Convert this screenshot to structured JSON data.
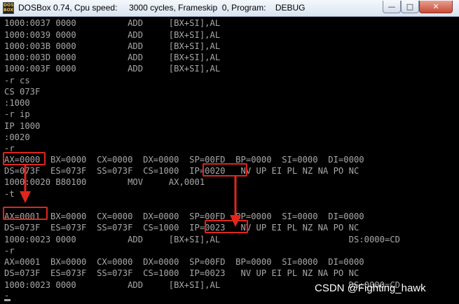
{
  "window": {
    "title": "DOSBox 0.74, Cpu speed:     3000 cycles, Frameskip  0, Program:    DEBUG",
    "icon_label": "DOS BOX",
    "minimize_glyph": "—",
    "maximize_glyph": "□",
    "close_glyph": "✕"
  },
  "terminal": {
    "lines": [
      "1000:0037 0000          ADD     [BX+SI],AL",
      "1000:0039 0000          ADD     [BX+SI],AL",
      "1000:003B 0000          ADD     [BX+SI],AL",
      "1000:003D 0000          ADD     [BX+SI],AL",
      "1000:003F 0000          ADD     [BX+SI],AL",
      "-r cs",
      "CS 073F",
      ":1000",
      "-r ip",
      "IP 1000",
      ":0020",
      "-r",
      "AX=0000  BX=0000  CX=0000  DX=0000  SP=00FD  BP=0000  SI=0000  DI=0000",
      "DS=073F  ES=073F  SS=073F  CS=1000  IP=0020   NV UP EI PL NZ NA PO NC",
      "1000:0020 B80100        MOV     AX,0001",
      "-t",
      "",
      "AX=0001  BX=0000  CX=0000  DX=0000  SP=00FD  BP=0000  SI=0000  DI=0000",
      "DS=073F  ES=073F  SS=073F  CS=1000  IP=0023   NV UP EI PL NZ NA PO NC",
      "1000:0023 0000          ADD     [BX+SI],AL                         DS:0000=CD",
      "-r",
      "AX=0001  BX=0000  CX=0000  DX=0000  SP=00FD  BP=0000  SI=0000  DI=0000",
      "DS=073F  ES=073F  SS=073F  CS=1000  IP=0023   NV UP EI PL NZ NA PO NC",
      "1000:0023 0000          ADD     [BX+SI],AL                         DS:0000=CD",
      "-"
    ]
  },
  "annotations": {
    "color": "#e0261c",
    "highlights": [
      "AX=0000",
      "IP=0020",
      "AX=0001",
      "IP=0023"
    ]
  },
  "watermark": "CSDN @Fighting_hawk",
  "colors": {
    "terminal_text": "#a8a8a8",
    "terminal_bg": "#000000"
  }
}
